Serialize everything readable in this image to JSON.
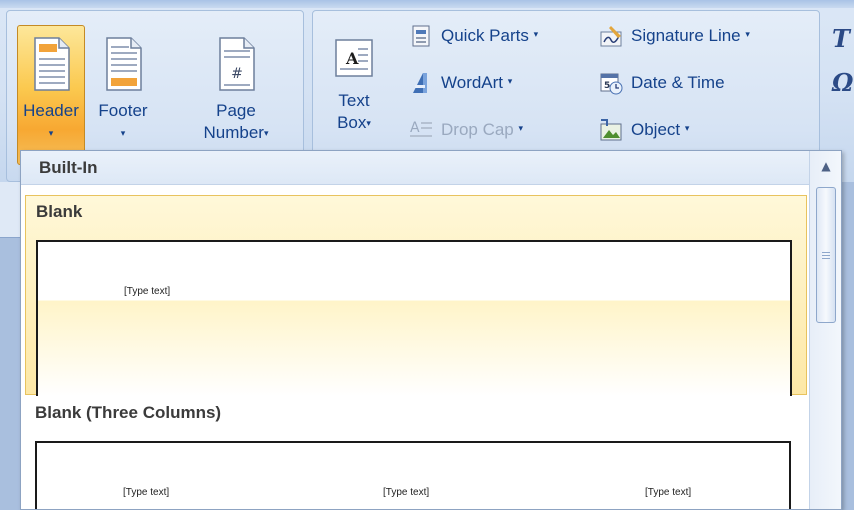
{
  "ribbon": {
    "header_footer_group": {
      "header": {
        "label": "Header",
        "arrow": "▾"
      },
      "footer": {
        "label": "Footer",
        "arrow": "▾"
      },
      "page_number": {
        "label_line1": "Page",
        "label_line2": "Number",
        "arrow": "▾"
      }
    },
    "text_group": {
      "text_box": {
        "label_line1": "Text",
        "label_line2": "Box",
        "arrow": "▾"
      },
      "quick_parts": {
        "label": "Quick Parts",
        "arrow": "▾"
      },
      "wordart": {
        "label": "WordArt",
        "arrow": "▾"
      },
      "drop_cap": {
        "label": "Drop Cap",
        "arrow": "▾",
        "disabled": true
      },
      "signature_line": {
        "label": "Signature Line",
        "arrow": "▾"
      },
      "date_time": {
        "label": "Date & Time"
      },
      "object": {
        "label": "Object",
        "arrow": "▾"
      }
    },
    "edge_glyph_top": "T",
    "edge_glyph_bottom": "Ω"
  },
  "gallery": {
    "section_header": "Built-In",
    "items": [
      {
        "title": "Blank",
        "placeholders": [
          "[Type text]"
        ],
        "selected": true
      },
      {
        "title": "Blank (Three Columns)",
        "placeholders": [
          "[Type text]",
          "[Type text]",
          "[Type text]"
        ],
        "selected": false
      }
    ]
  },
  "colors": {
    "accent_hover": "#fde8a6",
    "active_button": "#fbc94f",
    "ribbon_text": "#15428b"
  }
}
